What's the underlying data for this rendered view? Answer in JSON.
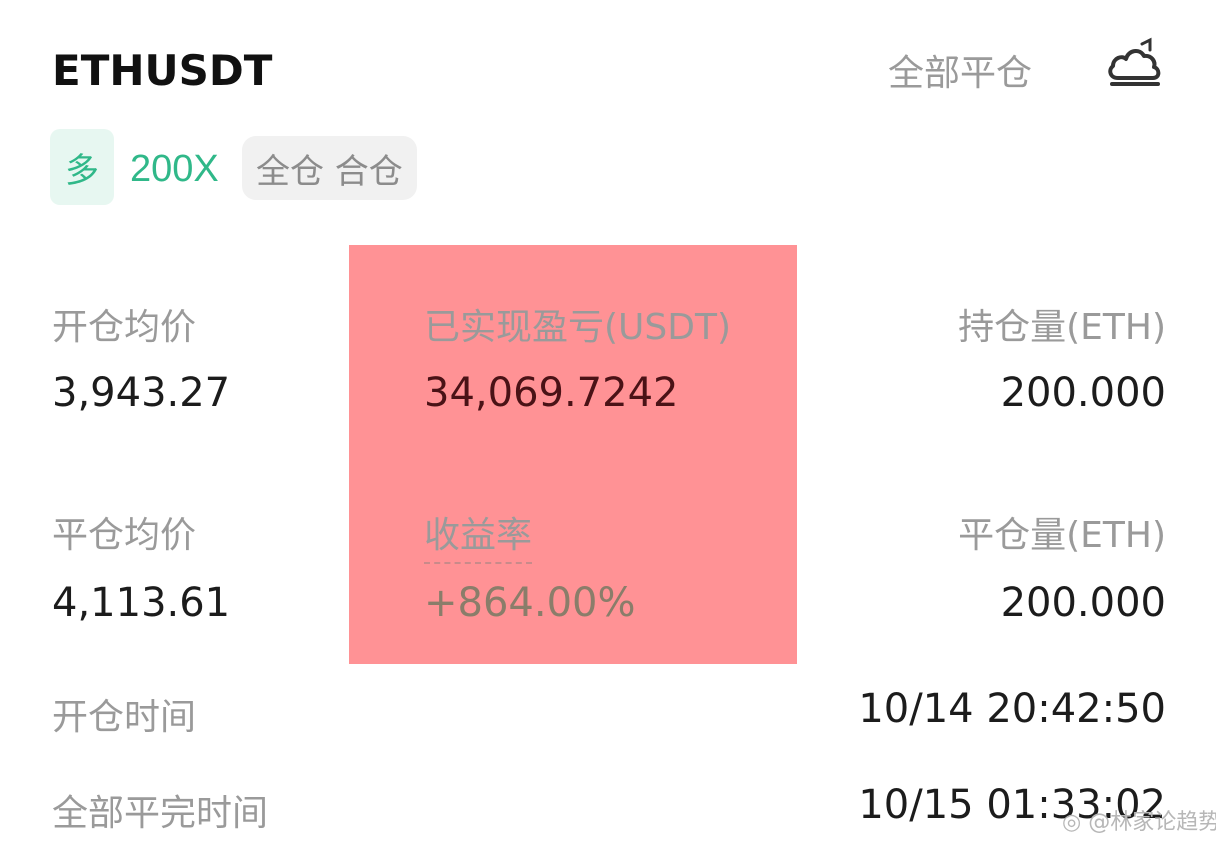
{
  "header": {
    "symbol": "ETHUSDT",
    "close_all_label": "全部平仓",
    "share_icon": "cloud-share-icon"
  },
  "tags": {
    "side": "多",
    "leverage": "200X",
    "margin_mode": "全仓 合仓"
  },
  "stats": {
    "open_avg_price": {
      "label": "开仓均价",
      "value": "3,943.27"
    },
    "realized_pnl": {
      "label": "已实现盈亏(USDT)",
      "value": "34,069.7242"
    },
    "position_size": {
      "label": "持仓量(ETH)",
      "value": "200.000"
    },
    "close_avg_price": {
      "label": "平仓均价",
      "value": "4,113.61"
    },
    "return_rate": {
      "label": "收益率",
      "value": "+864.00%"
    },
    "closed_size": {
      "label": "平仓量(ETH)",
      "value": "200.000"
    },
    "open_time": {
      "label": "开仓时间",
      "value": "10/14 20:42:50"
    },
    "close_all_time": {
      "label": "全部平完时间",
      "value": "10/15 01:33:02"
    }
  },
  "watermark": "◎ @林家论趋势",
  "colors": {
    "long_green": "#30b889",
    "highlight_red": "#ff9295",
    "label_gray": "#9a9a9a",
    "value_black": "#1c1c1c"
  }
}
